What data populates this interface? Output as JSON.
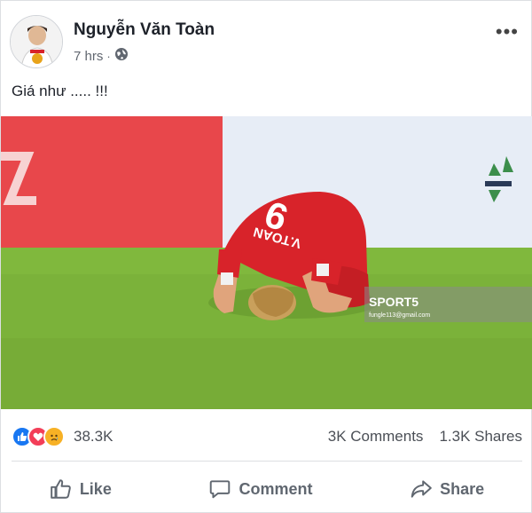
{
  "post": {
    "author": "Nguyễn Văn Toàn",
    "time": "7 hrs",
    "separator": "·",
    "privacy_icon": "globe-icon",
    "caption": "Giá như ..... !!!",
    "more_label": "•••"
  },
  "photo": {
    "jersey_number": "9",
    "jersey_name": "V.TOAN",
    "watermark_brand": "SPORT5",
    "watermark_sub": "fungle113@gmail.com"
  },
  "stats": {
    "reaction_icons": [
      "like-icon",
      "love-icon",
      "sad-icon"
    ],
    "reactions_count": "38.3K",
    "comments": "3K Comments",
    "shares": "1.3K Shares"
  },
  "actions": {
    "like": "Like",
    "comment": "Comment",
    "share": "Share"
  },
  "colors": {
    "like_blue": "#1877f2",
    "love_red": "#f33e58",
    "sad_yellow": "#f7b125",
    "pitch_green": "#7bb23a",
    "jersey_red": "#d8232a"
  }
}
